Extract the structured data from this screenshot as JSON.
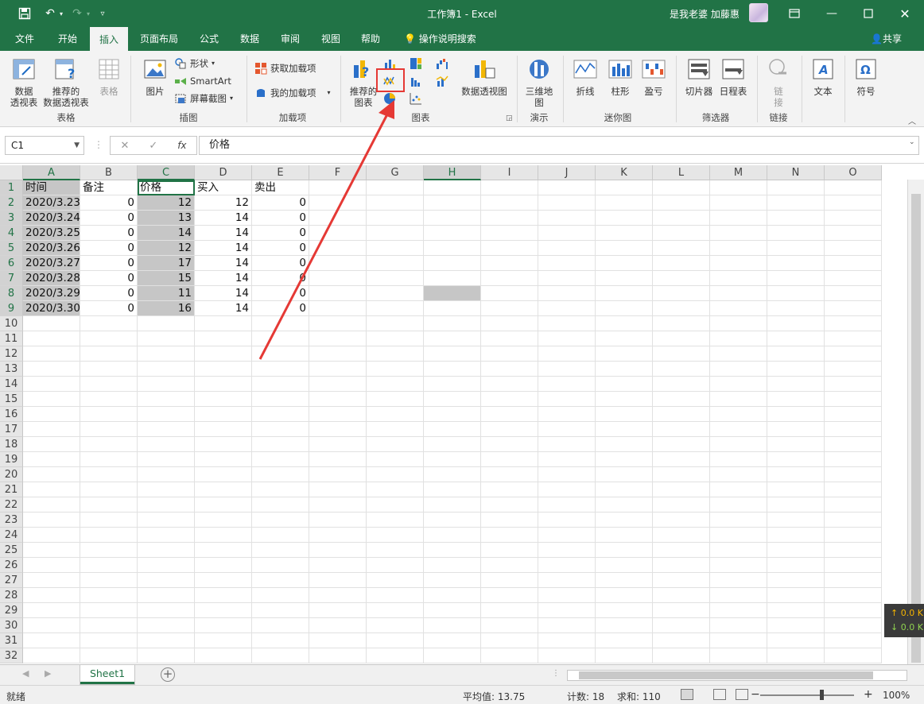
{
  "titlebar": {
    "doc_title": "工作簿1  -  Excel",
    "user": "是我老婆 加藤惠"
  },
  "tabs": [
    "文件",
    "开始",
    "插入",
    "页面布局",
    "公式",
    "数据",
    "审阅",
    "视图",
    "帮助"
  ],
  "tell_me": "操作说明搜索",
  "share": "共享",
  "ribbon": {
    "table_group": {
      "label": "表格",
      "pivot": "数据\n透视表",
      "recommended_pivot": "推荐的\n数据透视表",
      "table": "表格"
    },
    "illustrations": {
      "label": "插图",
      "picture": "图片",
      "shapes": "形状",
      "smartart": "SmartArt",
      "screenshot": "屏幕截图"
    },
    "addins": {
      "label": "加载项",
      "get": "获取加载项",
      "my": "我的加载项"
    },
    "charts": {
      "label": "图表",
      "recommended": "推荐的\n图表",
      "pivotchart": "数据透视图"
    },
    "tours": {
      "label": "演示",
      "map3d": "三维地\n图"
    },
    "sparklines": {
      "label": "迷你图",
      "line": "折线",
      "column": "柱形",
      "winloss": "盈亏"
    },
    "filters": {
      "label": "筛选器",
      "slicer": "切片器",
      "timeline": "日程表"
    },
    "links": {
      "label": "链接",
      "link": "链\n接"
    },
    "text": {
      "label": "文本"
    },
    "symbols": {
      "label": "符号"
    }
  },
  "formula_bar": {
    "name_box": "C1",
    "fx": "fx",
    "value": "价格"
  },
  "columns": [
    "A",
    "B",
    "C",
    "D",
    "E",
    "F",
    "G",
    "H",
    "I",
    "J",
    "K",
    "L",
    "M",
    "N",
    "O"
  ],
  "rows": [
    "1",
    "2",
    "3",
    "4",
    "5",
    "6",
    "7",
    "8",
    "9",
    "10",
    "11",
    "12",
    "13",
    "14",
    "15",
    "16",
    "17",
    "18",
    "19",
    "20",
    "21",
    "22",
    "23",
    "24",
    "25",
    "26",
    "27",
    "28",
    "29",
    "30",
    "31",
    "32"
  ],
  "sheet": {
    "headers": [
      "时间",
      "备注",
      "价格",
      "买入",
      "卖出"
    ],
    "data": [
      [
        "2020/3.23",
        "0",
        "12",
        "12",
        "0"
      ],
      [
        "2020/3.24",
        "0",
        "13",
        "14",
        "0"
      ],
      [
        "2020/3.25",
        "0",
        "14",
        "14",
        "0"
      ],
      [
        "2020/3.26",
        "0",
        "12",
        "14",
        "0"
      ],
      [
        "2020/3.27",
        "0",
        "17",
        "14",
        "0"
      ],
      [
        "2020/3.28",
        "0",
        "15",
        "14",
        "0"
      ],
      [
        "2020/3.29",
        "0",
        "11",
        "14",
        "0"
      ],
      [
        "2020/3.30",
        "0",
        "16",
        "14",
        "0"
      ]
    ]
  },
  "sheet_tab": "Sheet1",
  "status": {
    "ready": "就绪",
    "average": "平均值: 13.75",
    "count": "计数: 18",
    "sum": "求和: 110",
    "zoom": "100%"
  },
  "netspeed": {
    "up": "↑ 0.0 K",
    "down": "↓ 0.0 K"
  },
  "colors": {
    "excel_green": "#217346",
    "annotation_red": "#e53935",
    "selection_gray": "#c6c6c6"
  }
}
